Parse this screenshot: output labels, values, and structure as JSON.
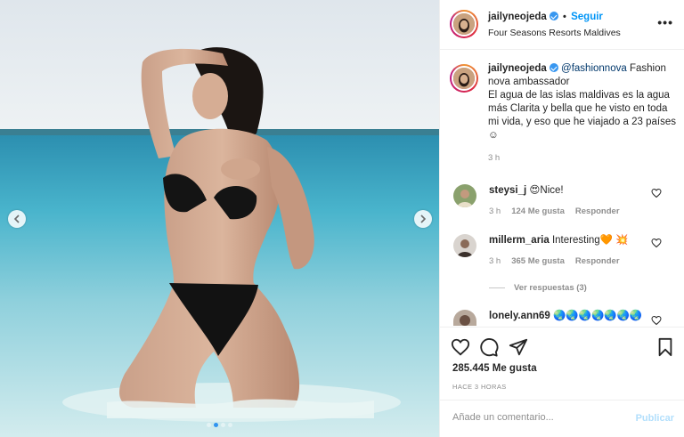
{
  "post": {
    "username": "jailyneojeda",
    "follow_label": "Seguir",
    "separator": "•",
    "location": "Four Seasons Resorts Maldives",
    "more_label": "•••",
    "caption_mention": "@fashionnova",
    "caption_text": " Fashion nova ambassador\nEl agua de las islas maldivas es la agua más Clarita y bella que he visto en toda mi vida, y eso que he viajado a 23 países ☺",
    "caption_time": "3 h"
  },
  "comments": [
    {
      "user": "steysi_j",
      "text": "😍Nice!",
      "time": "3 h",
      "likes": "124 Me gusta",
      "reply": "Responder"
    },
    {
      "user": "millerm_aria",
      "text": "Interesting🧡 💥",
      "time": "3 h",
      "likes": "365 Me gusta",
      "reply": "Responder"
    },
    {
      "user": "lonely.ann69",
      "text": "🌏🌏🌏🌏🌏🌏🌏"
    }
  ],
  "view_replies": "Ver respuestas (3)",
  "likes_count": "285.445 Me gusta",
  "posted_ago": "HACE 3 HORAS",
  "comment_input": {
    "placeholder": "Añade un comentario...",
    "publish_label": "Publicar"
  },
  "icons": {
    "like": "heart-icon",
    "comment": "comment-icon",
    "share": "share-icon",
    "save": "bookmark-icon",
    "prev": "chevron-left-icon",
    "next": "chevron-right-icon"
  },
  "colors": {
    "accent": "#0095f6",
    "verified": "#3897f0",
    "publish_disabled": "#b2dffc"
  },
  "carousel": {
    "total": 4,
    "active_index": 1
  }
}
